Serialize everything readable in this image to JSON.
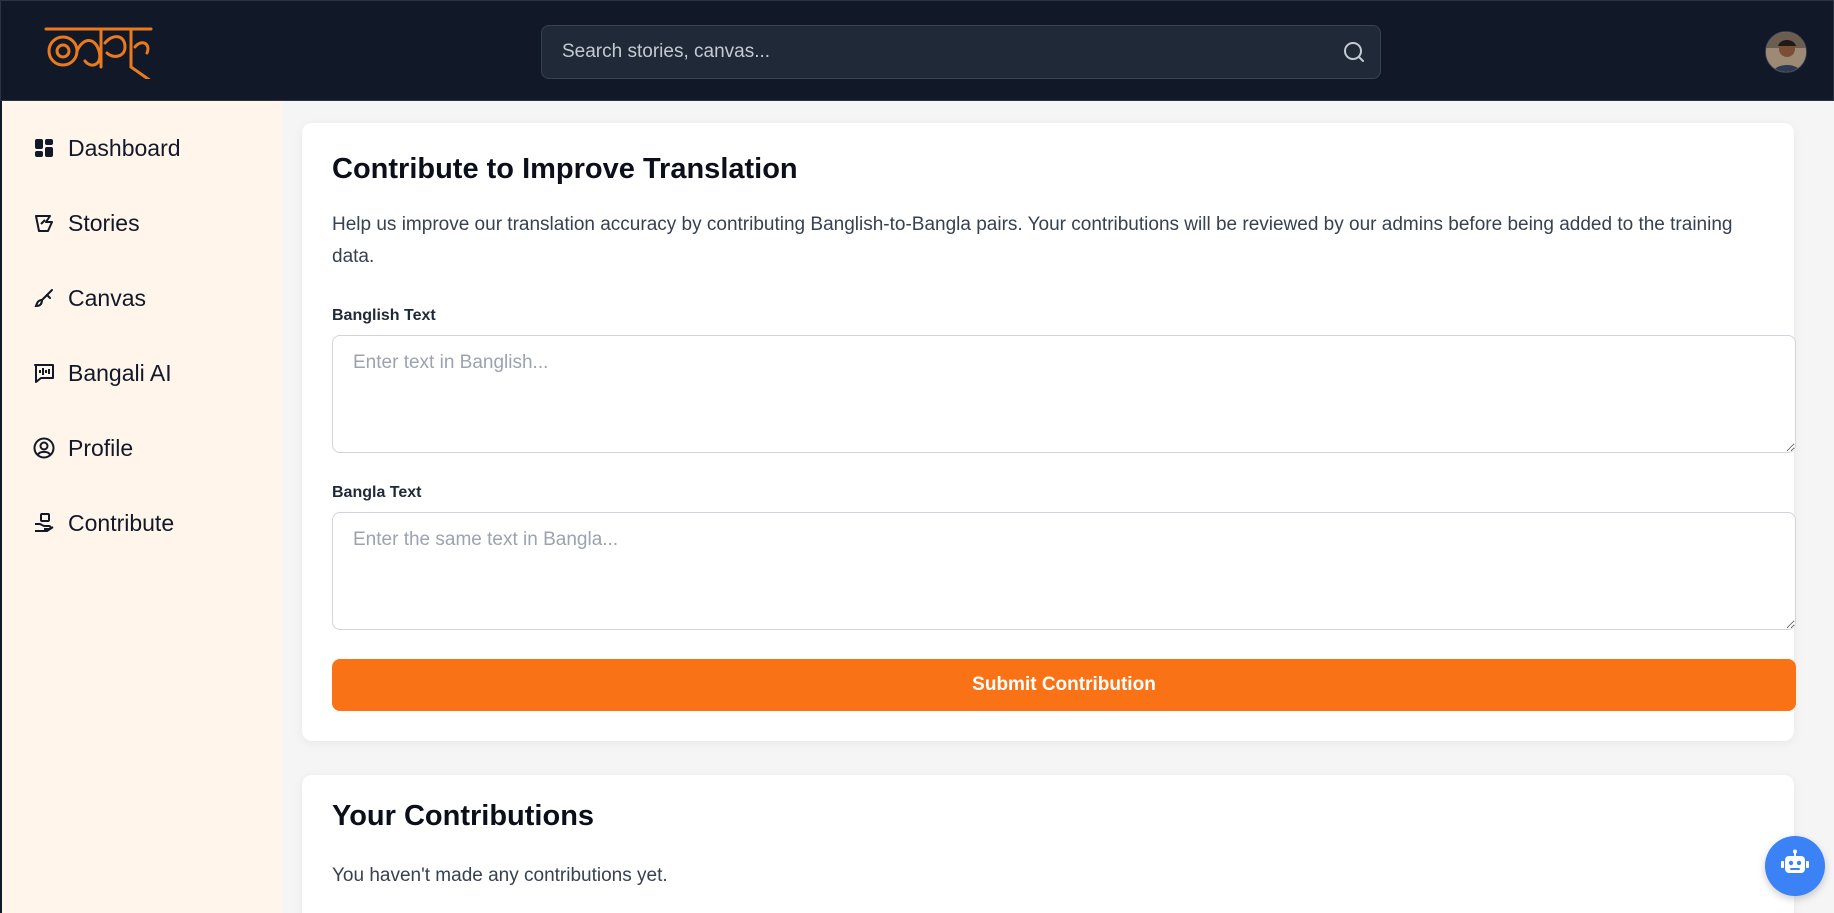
{
  "header": {
    "search": {
      "placeholder": "Search stories, canvas...",
      "value": ""
    },
    "icons": {
      "logo": "brand-logo",
      "search": "search-icon",
      "avatar": "user-avatar"
    },
    "colors": {
      "background": "#111827",
      "logo": "#ea7a1e"
    }
  },
  "sidebar": {
    "background": "#fff5eb",
    "items": [
      {
        "label": "Dashboard",
        "icon": "dashboard-icon"
      },
      {
        "label": "Stories",
        "icon": "stories-icon"
      },
      {
        "label": "Canvas",
        "icon": "brush-icon"
      },
      {
        "label": "Bangali AI",
        "icon": "chat-ai-icon"
      },
      {
        "label": "Profile",
        "icon": "profile-icon"
      },
      {
        "label": "Contribute",
        "icon": "contribute-icon"
      }
    ]
  },
  "contribute_form": {
    "title": "Contribute to Improve Translation",
    "description": "Help us improve our translation accuracy by contributing Banglish-to-Bangla pairs. Your contributions will be reviewed by our admins before being added to the training data.",
    "banglish": {
      "label": "Banglish Text",
      "placeholder": "Enter text in Banglish...",
      "value": ""
    },
    "bangla": {
      "label": "Bangla Text",
      "placeholder": "Enter the same text in Bangla...",
      "value": ""
    },
    "submit_label": "Submit Contribution",
    "accent": "#f97316"
  },
  "contributions": {
    "title": "Your Contributions",
    "empty_text": "You haven't made any contributions yet."
  },
  "chat_bot": {
    "icon": "robot-icon",
    "color": "#3b82f6"
  }
}
